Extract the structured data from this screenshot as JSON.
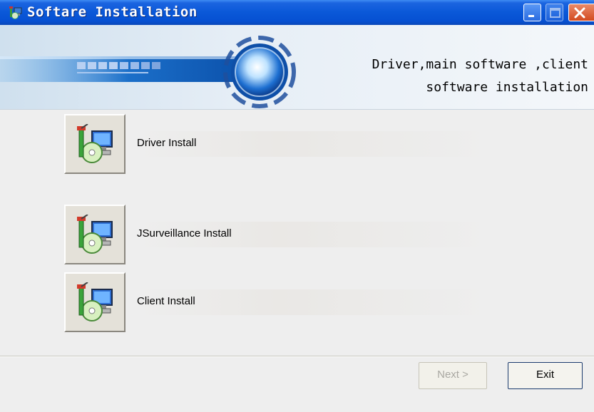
{
  "window": {
    "title": "Softare Installation",
    "buttons": {
      "minimize_icon": "minimize-icon",
      "maximize_icon": "maximize-icon",
      "close_icon": "close-icon"
    }
  },
  "header": {
    "line1": "Driver,main software ,client",
    "line2": "software installation"
  },
  "installers": [
    {
      "label": "Driver Install",
      "icon": "setup-icon"
    },
    {
      "label": "JSurveillance Install",
      "icon": "setup-icon"
    },
    {
      "label": "Client Install",
      "icon": "setup-icon"
    }
  ],
  "footer": {
    "next_label": "Next >",
    "exit_label": "Exit"
  },
  "colors": {
    "titlebar": "#0a58d8",
    "close_button": "#d34a1f",
    "window_bg": "#eeeeee"
  }
}
